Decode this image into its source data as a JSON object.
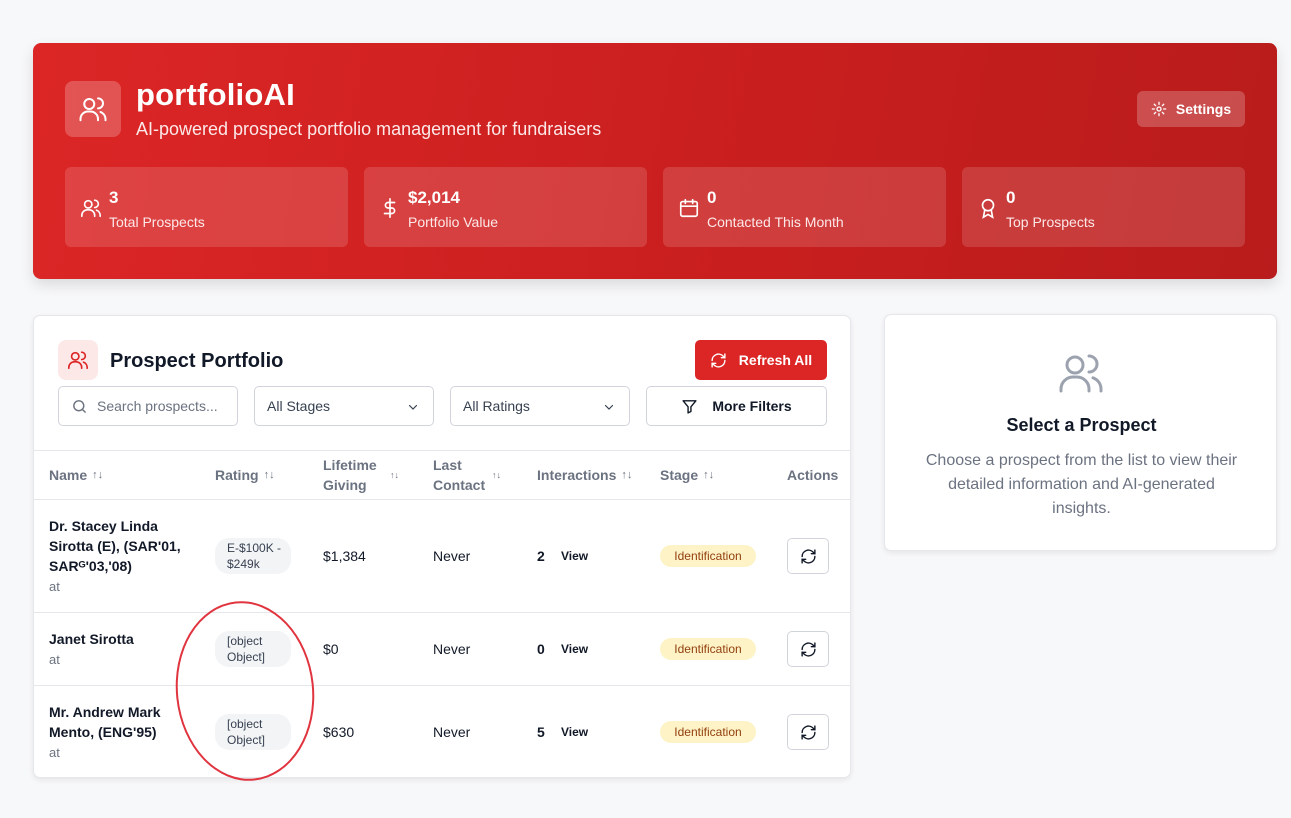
{
  "header": {
    "title": "portfolioAI",
    "subtitle": "AI-powered prospect portfolio management for fundraisers",
    "settings_label": "Settings",
    "stats": [
      {
        "value": "3",
        "label": "Total Prospects",
        "icon": "users-icon"
      },
      {
        "value": "$2,014",
        "label": "Portfolio Value",
        "icon": "dollar-icon"
      },
      {
        "value": "0",
        "label": "Contacted This Month",
        "icon": "calendar-icon"
      },
      {
        "value": "0",
        "label": "Top Prospects",
        "icon": "award-icon"
      }
    ]
  },
  "portfolio": {
    "title": "Prospect Portfolio",
    "refresh_label": "Refresh All",
    "search_placeholder": "Search prospects...",
    "stage_filter": "All Stages",
    "rating_filter": "All Ratings",
    "more_filters_label": "More Filters",
    "columns": {
      "name": "Name",
      "rating": "Rating",
      "lifetime_giving": "Lifetime Giving",
      "last_contact": "Last Contact",
      "interactions": "Interactions",
      "stage": "Stage",
      "actions": "Actions"
    },
    "sort_glyph": "↑↓",
    "rows": [
      {
        "name": "Dr. Stacey Linda Sirotta (E), (SAR'01, SARᴳ'03,'08)",
        "subtitle": "at",
        "rating": "E-$100K - $249k",
        "lifetime_giving": "$1,384",
        "last_contact": "Never",
        "interactions": "2",
        "view_label": "View",
        "stage": "Identification"
      },
      {
        "name": "Janet Sirotta",
        "subtitle": "at",
        "rating": "[object Object]",
        "lifetime_giving": "$0",
        "last_contact": "Never",
        "interactions": "0",
        "view_label": "View",
        "stage": "Identification"
      },
      {
        "name": "Mr. Andrew Mark Mento, (ENG'95)",
        "subtitle": "at",
        "rating": "[object Object]",
        "lifetime_giving": "$630",
        "last_contact": "Never",
        "interactions": "5",
        "view_label": "View",
        "stage": "Identification"
      }
    ]
  },
  "detail": {
    "title": "Select a Prospect",
    "description": "Choose a prospect from the list to view their detailed information and AI-generated insights."
  },
  "colors": {
    "brand_red": "#dc2626",
    "stage_badge_bg": "#fef3c7",
    "annotation_red": "#e0343f"
  }
}
